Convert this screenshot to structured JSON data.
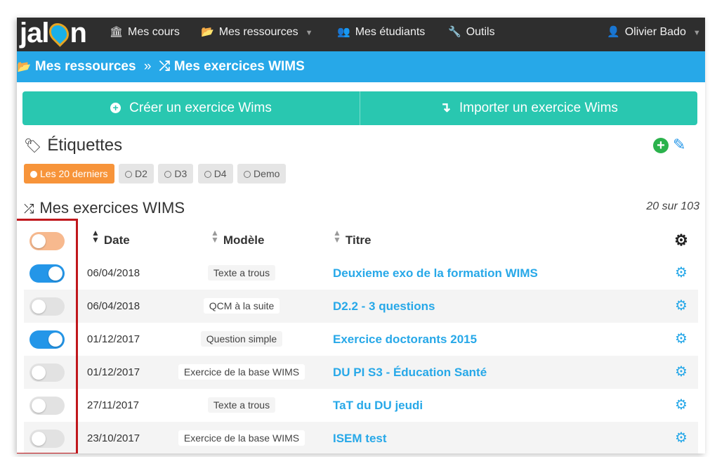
{
  "nav": {
    "logo": "jalon",
    "items": [
      {
        "icon": "bank-icon",
        "label": "Mes cours"
      },
      {
        "icon": "folder-open-icon",
        "label": "Mes ressources"
      },
      {
        "icon": "users-icon",
        "label": "Mes étudiants"
      },
      {
        "icon": "wrench-icon",
        "label": "Outils"
      }
    ],
    "user": "Olivier Bado"
  },
  "breadcrumb": {
    "parent": "Mes ressources",
    "separator": "»",
    "current": "Mes exercices WIMS"
  },
  "actions": {
    "create": "Créer un exercice Wims",
    "import": "Importer un exercice Wims"
  },
  "labels": {
    "title": "Étiquettes",
    "tags": [
      {
        "label": "Les 20 derniers",
        "active": true
      },
      {
        "label": "D2",
        "active": false
      },
      {
        "label": "D3",
        "active": false
      },
      {
        "label": "D4",
        "active": false
      },
      {
        "label": "Demo",
        "active": false
      }
    ]
  },
  "list": {
    "title": "Mes exercices WIMS",
    "count": "20 sur 103",
    "columns": {
      "date": "Date",
      "model": "Modèle",
      "title": "Titre"
    },
    "rows": [
      {
        "selected": true,
        "date": "06/04/2018",
        "model": "Texte a trous",
        "title": "Deuxieme exo de la formation WIMS"
      },
      {
        "selected": false,
        "date": "06/04/2018",
        "model": "QCM à la suite",
        "title": "D2.2 - 3 questions"
      },
      {
        "selected": true,
        "date": "01/12/2017",
        "model": "Question simple",
        "title": "Exercice doctorants 2015"
      },
      {
        "selected": false,
        "date": "01/12/2017",
        "model": "Exercice de la base WIMS",
        "title": "DU PI S3 - Éducation Santé"
      },
      {
        "selected": false,
        "date": "27/11/2017",
        "model": "Texte a trous",
        "title": "TaT du DU jeudi"
      },
      {
        "selected": false,
        "date": "23/10/2017",
        "model": "Exercice de la base WIMS",
        "title": "ISEM test"
      }
    ]
  },
  "colors": {
    "nav_bg": "#2e2e2e",
    "breadcrumb_bg": "#27a8e8",
    "action_bg": "#29c7b0",
    "active_tag": "#f7943a",
    "toggle_on": "#2496e8",
    "highlight": "#c0171c"
  }
}
